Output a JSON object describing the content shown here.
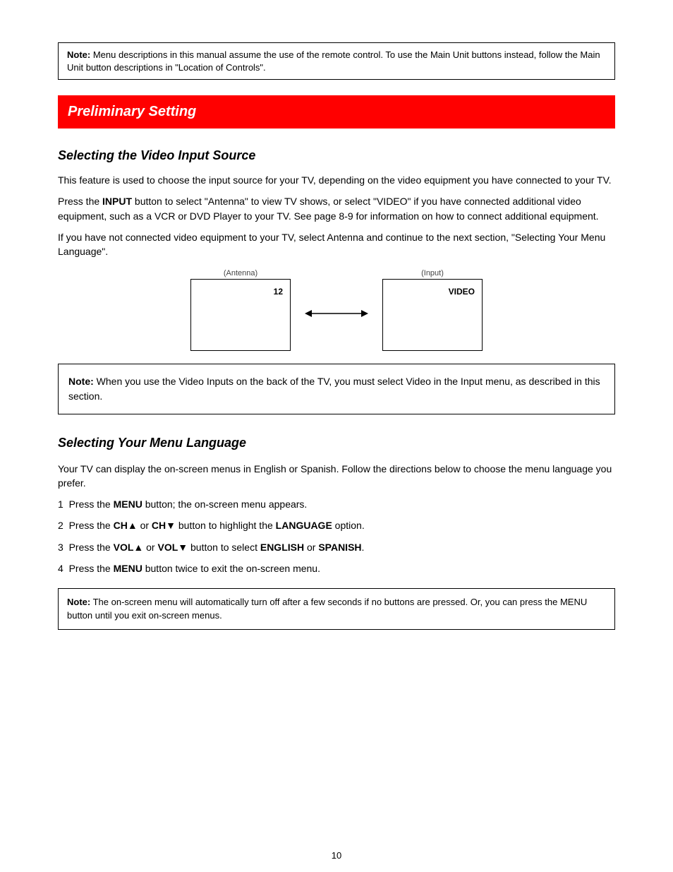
{
  "topNote": {
    "bold": "Note:",
    "text": " Menu descriptions in this manual assume the use of the remote control. To use the Main Unit buttons instead, follow the Main Unit button descriptions in \"Location of Controls\"."
  },
  "sectionTitle": "Preliminary Setting",
  "heading1": "Selecting the Video Input Source",
  "para1": "This feature is used to choose the input source for your TV, depending on the video equipment you have connected to your TV.",
  "para2": {
    "pre": "Press the ",
    "key": "INPUT",
    "post": " button to select \"Antenna\" to view TV shows, or select \"VIDEO\" if you have connected additional video equipment, such as a VCR or DVD Player to your TV. See page 8-9 for information on how to connect additional equipment."
  },
  "para3": "If you have not connected video equipment to your TV, select Antenna and continue to the next section, \"Selecting Your Menu Language\".",
  "diagram": {
    "leftLabel": "(Antenna)",
    "leftValue": "12",
    "rightLabel": "(Input)",
    "rightValue": "VIDEO"
  },
  "midNote": {
    "bold": "Note:",
    "text": " When you use the Video Inputs on the back of the TV, you must select Video in the Input menu, as described in this section."
  },
  "heading2": "Selecting Your Menu Language",
  "para4": "Your TV can display the on-screen menus in English or Spanish. Follow the directions below to choose the menu language you prefer.",
  "steps": [
    {
      "n": "1",
      "pre": "Press the ",
      "key": "MENU",
      "post": " button; the on-screen menu appears."
    },
    {
      "n": "2",
      "pre": "Press the ",
      "key": "CH▲",
      "mid": " or ",
      "key2": "CH▼",
      "mid2": " button to highlight the ",
      "key3": "LANGUAGE",
      "post": " option."
    },
    {
      "n": "3",
      "pre": "Press the ",
      "key": "VOL▲",
      "mid": " or ",
      "key2": "VOL▼",
      "mid2": " button to select ",
      "key3": "ENGLISH",
      "mid3": " or ",
      "key4": "SPANISH",
      "post": "."
    },
    {
      "n": "4",
      "pre": "Press the ",
      "key": "MENU",
      "post": " button twice to exit the on-screen menu."
    }
  ],
  "bottomNote": {
    "bold": "Note:",
    "text": " The on-screen menu will automatically turn off after a few seconds if no buttons are pressed. Or, you can press the MENU button until you exit on-screen menus."
  },
  "pageNumber": "10"
}
